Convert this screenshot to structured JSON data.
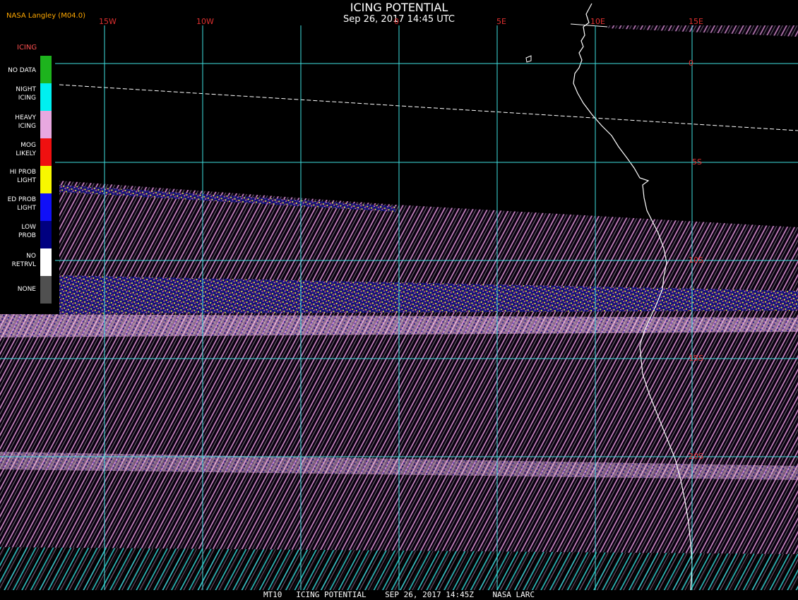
{
  "header": {
    "title": "ICING POTENTIAL",
    "timestamp": "Sep 26, 2017 14:45 UTC",
    "producer": "NASA Langley (M04.0)"
  },
  "legend": {
    "title": "ICING",
    "items": [
      {
        "label": "NO DATA",
        "color": "#1db31d"
      },
      {
        "label": "NIGHT\nICING",
        "color": "#00f0f0"
      },
      {
        "label": "HEAVY\nICING",
        "color": "#e8a8e0"
      },
      {
        "label": "MOG\nLIKELY",
        "color": "#f01010"
      },
      {
        "label": "HI PROB\nLIGHT",
        "color": "#f8f800"
      },
      {
        "label": "ED PROB\nLIGHT",
        "color": "#1010f8"
      },
      {
        "label": "LOW\nPROB",
        "color": "#000080"
      },
      {
        "label": "NO\nRETRVL",
        "color": "#ffffff"
      },
      {
        "label": "NONE",
        "color": "#505050"
      }
    ]
  },
  "grid": {
    "longitude_labels": [
      "15W",
      "10W",
      "0",
      "5E",
      "10E",
      "15E"
    ],
    "latitude_labels": [
      "0",
      "5S",
      "10S",
      "15S",
      "20S"
    ],
    "line_color": "#40e0e0"
  },
  "footer": "MT10   ICING POTENTIAL    SEP 26, 2017 14:45Z    NASA LARC"
}
